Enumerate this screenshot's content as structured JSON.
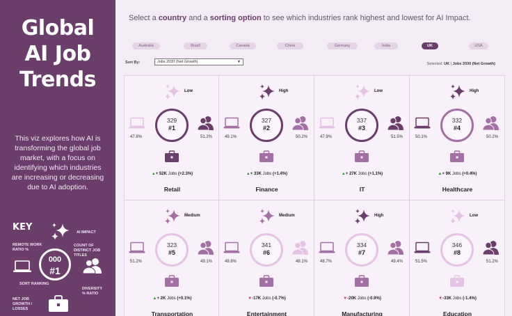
{
  "sidebar": {
    "title_lines": [
      "Global",
      "AI Job",
      "Trends"
    ],
    "description": "This viz explores how AI is transforming the global job market, with a focus on identifying which industries are increasing or decreasing due to AI adoption.",
    "key": {
      "title": "KEY",
      "ai_impact": "AI IMPACT",
      "remote_work": "REMOTE WORK RATIO %",
      "count_titles": "COUNT OF DISTINCT JOB TITLES",
      "sort_ranking": "SORT RANKING",
      "diversity": "DIVERSITY % RATIO",
      "net_job": "NET JOB GROWTH / LOSSES",
      "sample_num": "000",
      "sample_rank": "#1"
    }
  },
  "header": {
    "instr_1": "Select a ",
    "instr_country": "country",
    "instr_2": " and a ",
    "instr_sort": "sorting option",
    "instr_3": " to see which industries rank highest and lowest for AI Impact."
  },
  "countries": [
    {
      "label": "Australia",
      "selected": false
    },
    {
      "label": "Brazil",
      "selected": false
    },
    {
      "label": "Canada",
      "selected": false
    },
    {
      "label": "China",
      "selected": false
    },
    {
      "label": "Germany",
      "selected": false
    },
    {
      "label": "India",
      "selected": false
    },
    {
      "label": "UK",
      "selected": true
    },
    {
      "label": "USA",
      "selected": false
    }
  ],
  "sort": {
    "label": "Sort By:",
    "value": "Jobs 2030 (Net Growth)"
  },
  "selected_info": {
    "prefix": "Selected: ",
    "country": "UK",
    "sep": " | ",
    "sort": "Jobs 2030 (Net Growth)"
  },
  "colors": {
    "dark": "#6a3d6b",
    "mid": "#a46fa5",
    "light": "#e6c2e4",
    "up": "#3a8f3a",
    "down": "#c0403a"
  },
  "industries": [
    {
      "name": "Retail",
      "impact": "Low",
      "count": "329",
      "rank": "#1",
      "remote": "47.8%",
      "diversity": "51.2%",
      "dir": "up",
      "jobs": "+ 52K",
      "jobs_suffix": " Jobs ",
      "jobs_pct": "(+2.3%)",
      "laptop": "light",
      "people": "dark",
      "sparkle": "light",
      "ring": "dark",
      "bag": "dark"
    },
    {
      "name": "Finance",
      "impact": "High",
      "count": "327",
      "rank": "#2",
      "remote": "49.1%",
      "diversity": "50.2%",
      "dir": "up",
      "jobs": "+ 33K",
      "jobs_suffix": " Jobs ",
      "jobs_pct": "(+1.4%)",
      "laptop": "mid",
      "people": "mid",
      "sparkle": "dark",
      "ring": "dark",
      "bag": "mid"
    },
    {
      "name": "IT",
      "impact": "Low",
      "count": "337",
      "rank": "#3",
      "remote": "47.9%",
      "diversity": "51.5%",
      "dir": "up",
      "jobs": "+ 27K",
      "jobs_suffix": " Jobs ",
      "jobs_pct": "(+1.1%)",
      "laptop": "light",
      "people": "dark",
      "sparkle": "light",
      "ring": "dark",
      "bag": "mid"
    },
    {
      "name": "Healthcare",
      "impact": "High",
      "count": "332",
      "rank": "#4",
      "remote": "50.1%",
      "diversity": "50.2%",
      "dir": "up",
      "jobs": "+ 9K",
      "jobs_suffix": " Jobs ",
      "jobs_pct": "(+0.4%)",
      "laptop": "dark",
      "people": "mid",
      "sparkle": "dark",
      "ring": "mid",
      "bag": "mid"
    },
    {
      "name": "Transportation",
      "impact": "Medium",
      "count": "323",
      "rank": "#5",
      "remote": "51.2%",
      "diversity": "49.1%",
      "dir": "up",
      "jobs": "+ 2K",
      "jobs_suffix": " Jobs ",
      "jobs_pct": "(+0.1%)",
      "laptop": "mid",
      "people": "mid",
      "sparkle": "mid",
      "ring": "light",
      "bag": "mid"
    },
    {
      "name": "Entertainment",
      "impact": "Medium",
      "count": "341",
      "rank": "#6",
      "remote": "48.8%",
      "diversity": "48.1%",
      "dir": "down",
      "jobs": "-17K",
      "jobs_suffix": " Jobs ",
      "jobs_pct": "(-0.7%)",
      "laptop": "mid",
      "people": "light",
      "sparkle": "mid",
      "ring": "light",
      "bag": "mid"
    },
    {
      "name": "Manufacturing",
      "impact": "High",
      "count": "334",
      "rank": "#7",
      "remote": "48.7%",
      "diversity": "49.4%",
      "dir": "down",
      "jobs": "-20K",
      "jobs_suffix": " Jobs ",
      "jobs_pct": "(-0.9%)",
      "laptop": "mid",
      "people": "mid",
      "sparkle": "dark",
      "ring": "light",
      "bag": "mid"
    },
    {
      "name": "Education",
      "impact": "Low",
      "count": "346",
      "rank": "#8",
      "remote": "51.5%",
      "diversity": "51.2%",
      "dir": "down",
      "jobs": "-33K",
      "jobs_suffix": " Jobs ",
      "jobs_pct": "(-1.4%)",
      "laptop": "dark",
      "people": "dark",
      "sparkle": "light",
      "ring": "light",
      "bag": "light"
    }
  ]
}
